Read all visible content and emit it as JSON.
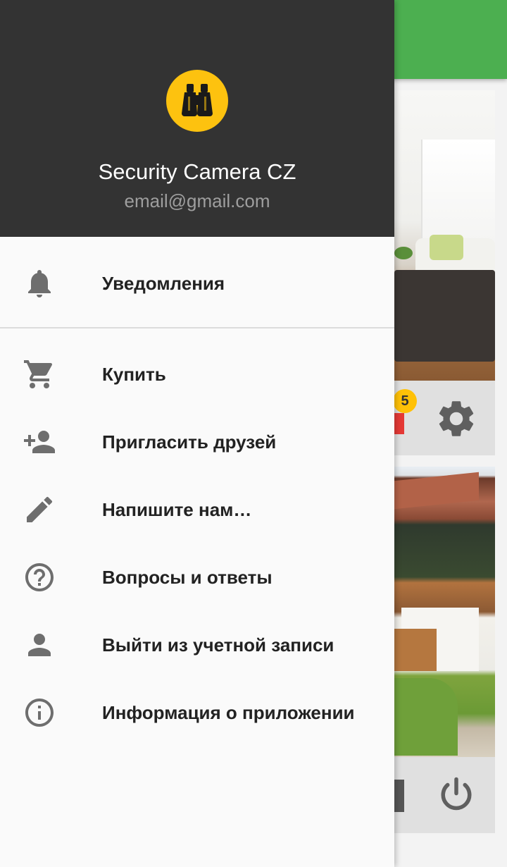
{
  "drawer": {
    "app_name": "Security Camera CZ",
    "email": "email@gmail.com",
    "logo_icon": "binoculars-icon",
    "items": [
      {
        "label": "Уведомления",
        "icon": "bell-icon"
      },
      {
        "label": "Купить",
        "icon": "cart-icon"
      },
      {
        "label": "Пригласить друзей",
        "icon": "person-add-icon"
      },
      {
        "label": "Напишите нам…",
        "icon": "pencil-icon"
      },
      {
        "label": "Вопросы и ответы",
        "icon": "help-circle-icon"
      },
      {
        "label": "Выйти из учетной записи",
        "icon": "person-icon"
      },
      {
        "label": "Информация о приложении",
        "icon": "info-icon"
      }
    ]
  },
  "background": {
    "toolbar_color": "#4caf50",
    "camera1_badge": "5",
    "camera1_settings_icon": "gear-icon",
    "camera2_power_icon": "power-icon"
  },
  "colors": {
    "header_bg": "#333333",
    "logo_bg": "#fdc20f",
    "icon_color": "#6e6e6e",
    "label_color": "#222222"
  }
}
